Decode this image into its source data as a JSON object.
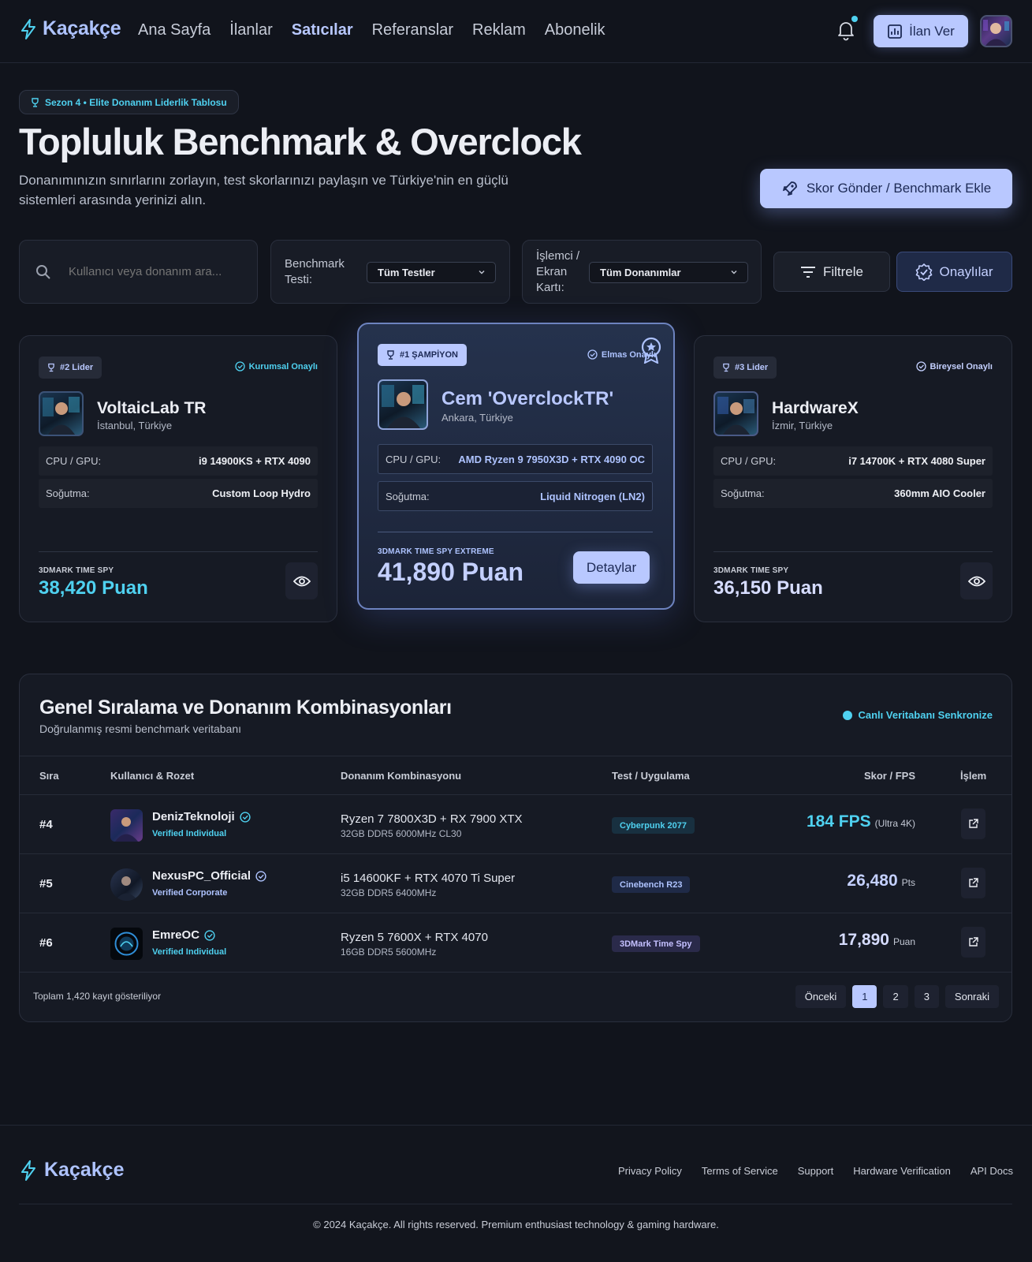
{
  "nav": {
    "brand": "Kaçakçe",
    "links": [
      "Ana Sayfa",
      "İlanlar",
      "Satıcılar",
      "Referanslar",
      "Reklam",
      "Abonelik"
    ],
    "active": "Satıcılar",
    "ilan_ver": "İlan Ver"
  },
  "hero": {
    "season": "Sezon 4 • Elite Donanım Liderlik Tablosu",
    "title": "Topluluk Benchmark & Overclock",
    "desc_line1": "Donanımınızın sınırlarını zorlayın, test skorlarınızı paylaşın ve Türkiye'nin en güçlü",
    "desc_line2": "sistemleri arasında yerinizi alın.",
    "submit": "Skor Gönder / Benchmark Ekle"
  },
  "filters": {
    "search_placeholder": "Kullanıcı veya donanım ara...",
    "benchmark_label_1": "Benchmark",
    "benchmark_label_2": "Testi:",
    "benchmark_value": "Tüm Testler",
    "hw_label_1": "İşlemci /",
    "hw_label_2": "Ekran",
    "hw_label_3": "Kartı:",
    "hw_value": "Tüm Donanımlar",
    "filter": "Filtrele",
    "verified": "Onaylılar"
  },
  "leaders": {
    "second": {
      "rank": "#2 Lider",
      "verif": "Kurumsal Onaylı",
      "name": "VoltaicLab TR",
      "loc": "İstanbul, Türkiye",
      "cpu_k": "CPU / GPU:",
      "cpu_v": "i9 14900KS + RTX 4090",
      "cool_k": "Soğutma:",
      "cool_v": "Custom Loop Hydro",
      "test": "3DMARK TIME SPY",
      "score": "38,420 Puan"
    },
    "first": {
      "rank": "#1 ŞAMPİYON",
      "verif": "Elmas Onaylı",
      "name": "Cem 'OverclockTR'",
      "loc": "Ankara, Türkiye",
      "cpu_k": "CPU / GPU:",
      "cpu_v": "AMD Ryzen 9 7950X3D + RTX 4090 OC",
      "cool_k": "Soğutma:",
      "cool_v": "Liquid Nitrogen (LN2)",
      "test": "3DMARK TIME SPY EXTREME",
      "score": "41,890 Puan",
      "detail": "Detaylar"
    },
    "third": {
      "rank": "#3 Lider",
      "verif": "Bireysel Onaylı",
      "name": "HardwareX",
      "loc": "İzmir, Türkiye",
      "cpu_k": "CPU / GPU:",
      "cpu_v": "i7 14700K + RTX 4080 Super",
      "cool_k": "Soğutma:",
      "cool_v": "360mm AIO Cooler",
      "test": "3DMARK TIME SPY",
      "score": "36,150 Puan"
    }
  },
  "ranking": {
    "title": "Genel Sıralama ve Donanım Kombinasyonları",
    "subtitle": "Doğrulanmış resmi benchmark veritabanı",
    "sync": "Canlı Veritabanı Senkronize",
    "headers": {
      "rank": "Sıra",
      "user": "Kullanıcı & Rozet",
      "hw": "Donanım Kombinasyonu",
      "test": "Test / Uygulama",
      "score": "Skor / FPS",
      "action": "İşlem"
    },
    "rows": [
      {
        "rank": "#4",
        "user": "DenizTeknoloji",
        "badge": "Verified Individual",
        "hw": "Ryzen 7 7800X3D + RX 7900 XTX",
        "hw2": "32GB DDR5 6000MHz CL30",
        "test": "Cyberpunk 2077",
        "score": "184 FPS",
        "unit": "(Ultra 4K)"
      },
      {
        "rank": "#5",
        "user": "NexusPC_Official",
        "badge": "Verified Corporate",
        "hw": "i5 14600KF + RTX 4070 Ti Super",
        "hw2": "32GB DDR5 6400MHz",
        "test": "Cinebench R23",
        "score": "26,480",
        "unit": "Pts"
      },
      {
        "rank": "#6",
        "user": "EmreOC",
        "badge": "Verified Individual",
        "hw": "Ryzen 5 7600X + RTX 4070",
        "hw2": "16GB DDR5 5600MHz",
        "test": "3DMark Time Spy",
        "score": "17,890",
        "unit": "Puan"
      }
    ],
    "total": "Toplam 1,420 kayıt gösteriliyor",
    "pager": {
      "prev": "Önceki",
      "p1": "1",
      "p2": "2",
      "p3": "3",
      "next": "Sonraki"
    }
  },
  "footer": {
    "brand": "Kaçakçe",
    "links": [
      "Privacy Policy",
      "Terms of Service",
      "Support",
      "Hardware Verification",
      "API Docs"
    ],
    "copy": "© 2024 Kaçakçe. All rights reserved. Premium enthusiast technology & gaming hardware."
  },
  "colors": {
    "accent": "#b9c8ff",
    "cyan": "#4fd1f0",
    "bg": "#11141c",
    "card": "#161a24"
  },
  "icons": [
    "bolt-icon",
    "bell-icon",
    "chart-icon",
    "trophy-icon",
    "rocket-icon",
    "search-icon",
    "chevron-down-icon",
    "filter-icon",
    "verified-badge-icon",
    "eye-icon",
    "award-icon",
    "external-link-icon"
  ]
}
